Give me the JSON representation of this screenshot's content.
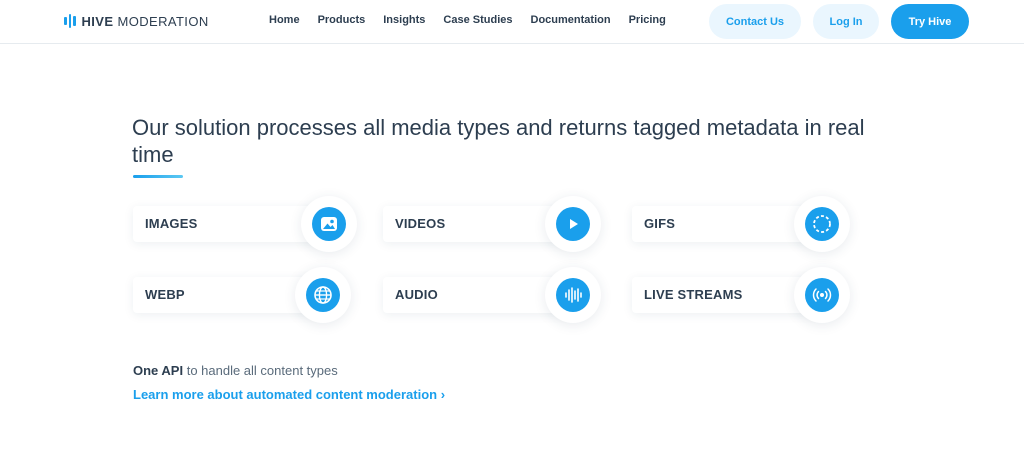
{
  "header": {
    "logo_bold": "HIVE",
    "logo_light": "MODERATION",
    "nav": [
      "Home",
      "Products",
      "Insights",
      "Case Studies",
      "Documentation",
      "Pricing"
    ],
    "contact_label": "Contact Us",
    "login_label": "Log In",
    "try_label": "Try Hive"
  },
  "main": {
    "headline": "Our solution processes all media types and returns tagged metadata in real time",
    "media": [
      {
        "label": "IMAGES",
        "icon": "image-icon"
      },
      {
        "label": "VIDEOS",
        "icon": "play-icon"
      },
      {
        "label": "GIFS",
        "icon": "gif-icon"
      },
      {
        "label": "WEBP",
        "icon": "globe-icon"
      },
      {
        "label": "AUDIO",
        "icon": "waveform-icon"
      },
      {
        "label": "LIVE STREAMS",
        "icon": "broadcast-icon"
      }
    ],
    "api_bold": "One API",
    "api_rest": " to handle all content types",
    "learn_more": "Learn more about automated content moderation",
    "learn_more_chevron": "›"
  },
  "colors": {
    "accent": "#1a9fec",
    "text": "#2d3e50",
    "button_light_bg": "#eaf6fe"
  }
}
